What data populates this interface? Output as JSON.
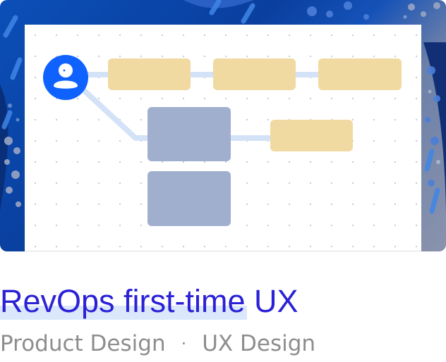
{
  "card": {
    "title": "RevOps first-time UX",
    "tags": [
      "Product Design",
      "UX Design"
    ],
    "separator": "·"
  },
  "colors": {
    "title": "#2b21d6",
    "title_highlight": "#dbe7fb",
    "meta": "#8d8d8d",
    "avatar": "#0f62fe",
    "node_tan": "#f0daa2",
    "node_slate": "#a1afcf",
    "connector": "#d3e2f7",
    "background_blue": "#0a3f9e"
  },
  "icons": {
    "avatar": "user-avatar-icon"
  }
}
